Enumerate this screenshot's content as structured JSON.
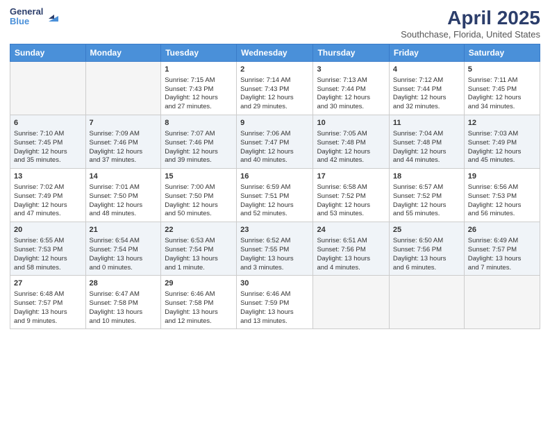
{
  "logo": {
    "general": "General",
    "blue": "Blue"
  },
  "header": {
    "title": "April 2025",
    "subtitle": "Southchase, Florida, United States"
  },
  "days": [
    "Sunday",
    "Monday",
    "Tuesday",
    "Wednesday",
    "Thursday",
    "Friday",
    "Saturday"
  ],
  "weeks": [
    [
      {
        "num": "",
        "lines": []
      },
      {
        "num": "",
        "lines": []
      },
      {
        "num": "1",
        "lines": [
          "Sunrise: 7:15 AM",
          "Sunset: 7:43 PM",
          "Daylight: 12 hours",
          "and 27 minutes."
        ]
      },
      {
        "num": "2",
        "lines": [
          "Sunrise: 7:14 AM",
          "Sunset: 7:43 PM",
          "Daylight: 12 hours",
          "and 29 minutes."
        ]
      },
      {
        "num": "3",
        "lines": [
          "Sunrise: 7:13 AM",
          "Sunset: 7:44 PM",
          "Daylight: 12 hours",
          "and 30 minutes."
        ]
      },
      {
        "num": "4",
        "lines": [
          "Sunrise: 7:12 AM",
          "Sunset: 7:44 PM",
          "Daylight: 12 hours",
          "and 32 minutes."
        ]
      },
      {
        "num": "5",
        "lines": [
          "Sunrise: 7:11 AM",
          "Sunset: 7:45 PM",
          "Daylight: 12 hours",
          "and 34 minutes."
        ]
      }
    ],
    [
      {
        "num": "6",
        "lines": [
          "Sunrise: 7:10 AM",
          "Sunset: 7:45 PM",
          "Daylight: 12 hours",
          "and 35 minutes."
        ]
      },
      {
        "num": "7",
        "lines": [
          "Sunrise: 7:09 AM",
          "Sunset: 7:46 PM",
          "Daylight: 12 hours",
          "and 37 minutes."
        ]
      },
      {
        "num": "8",
        "lines": [
          "Sunrise: 7:07 AM",
          "Sunset: 7:46 PM",
          "Daylight: 12 hours",
          "and 39 minutes."
        ]
      },
      {
        "num": "9",
        "lines": [
          "Sunrise: 7:06 AM",
          "Sunset: 7:47 PM",
          "Daylight: 12 hours",
          "and 40 minutes."
        ]
      },
      {
        "num": "10",
        "lines": [
          "Sunrise: 7:05 AM",
          "Sunset: 7:48 PM",
          "Daylight: 12 hours",
          "and 42 minutes."
        ]
      },
      {
        "num": "11",
        "lines": [
          "Sunrise: 7:04 AM",
          "Sunset: 7:48 PM",
          "Daylight: 12 hours",
          "and 44 minutes."
        ]
      },
      {
        "num": "12",
        "lines": [
          "Sunrise: 7:03 AM",
          "Sunset: 7:49 PM",
          "Daylight: 12 hours",
          "and 45 minutes."
        ]
      }
    ],
    [
      {
        "num": "13",
        "lines": [
          "Sunrise: 7:02 AM",
          "Sunset: 7:49 PM",
          "Daylight: 12 hours",
          "and 47 minutes."
        ]
      },
      {
        "num": "14",
        "lines": [
          "Sunrise: 7:01 AM",
          "Sunset: 7:50 PM",
          "Daylight: 12 hours",
          "and 48 minutes."
        ]
      },
      {
        "num": "15",
        "lines": [
          "Sunrise: 7:00 AM",
          "Sunset: 7:50 PM",
          "Daylight: 12 hours",
          "and 50 minutes."
        ]
      },
      {
        "num": "16",
        "lines": [
          "Sunrise: 6:59 AM",
          "Sunset: 7:51 PM",
          "Daylight: 12 hours",
          "and 52 minutes."
        ]
      },
      {
        "num": "17",
        "lines": [
          "Sunrise: 6:58 AM",
          "Sunset: 7:52 PM",
          "Daylight: 12 hours",
          "and 53 minutes."
        ]
      },
      {
        "num": "18",
        "lines": [
          "Sunrise: 6:57 AM",
          "Sunset: 7:52 PM",
          "Daylight: 12 hours",
          "and 55 minutes."
        ]
      },
      {
        "num": "19",
        "lines": [
          "Sunrise: 6:56 AM",
          "Sunset: 7:53 PM",
          "Daylight: 12 hours",
          "and 56 minutes."
        ]
      }
    ],
    [
      {
        "num": "20",
        "lines": [
          "Sunrise: 6:55 AM",
          "Sunset: 7:53 PM",
          "Daylight: 12 hours",
          "and 58 minutes."
        ]
      },
      {
        "num": "21",
        "lines": [
          "Sunrise: 6:54 AM",
          "Sunset: 7:54 PM",
          "Daylight: 13 hours",
          "and 0 minutes."
        ]
      },
      {
        "num": "22",
        "lines": [
          "Sunrise: 6:53 AM",
          "Sunset: 7:54 PM",
          "Daylight: 13 hours",
          "and 1 minute."
        ]
      },
      {
        "num": "23",
        "lines": [
          "Sunrise: 6:52 AM",
          "Sunset: 7:55 PM",
          "Daylight: 13 hours",
          "and 3 minutes."
        ]
      },
      {
        "num": "24",
        "lines": [
          "Sunrise: 6:51 AM",
          "Sunset: 7:56 PM",
          "Daylight: 13 hours",
          "and 4 minutes."
        ]
      },
      {
        "num": "25",
        "lines": [
          "Sunrise: 6:50 AM",
          "Sunset: 7:56 PM",
          "Daylight: 13 hours",
          "and 6 minutes."
        ]
      },
      {
        "num": "26",
        "lines": [
          "Sunrise: 6:49 AM",
          "Sunset: 7:57 PM",
          "Daylight: 13 hours",
          "and 7 minutes."
        ]
      }
    ],
    [
      {
        "num": "27",
        "lines": [
          "Sunrise: 6:48 AM",
          "Sunset: 7:57 PM",
          "Daylight: 13 hours",
          "and 9 minutes."
        ]
      },
      {
        "num": "28",
        "lines": [
          "Sunrise: 6:47 AM",
          "Sunset: 7:58 PM",
          "Daylight: 13 hours",
          "and 10 minutes."
        ]
      },
      {
        "num": "29",
        "lines": [
          "Sunrise: 6:46 AM",
          "Sunset: 7:58 PM",
          "Daylight: 13 hours",
          "and 12 minutes."
        ]
      },
      {
        "num": "30",
        "lines": [
          "Sunrise: 6:46 AM",
          "Sunset: 7:59 PM",
          "Daylight: 13 hours",
          "and 13 minutes."
        ]
      },
      {
        "num": "",
        "lines": []
      },
      {
        "num": "",
        "lines": []
      },
      {
        "num": "",
        "lines": []
      }
    ]
  ]
}
